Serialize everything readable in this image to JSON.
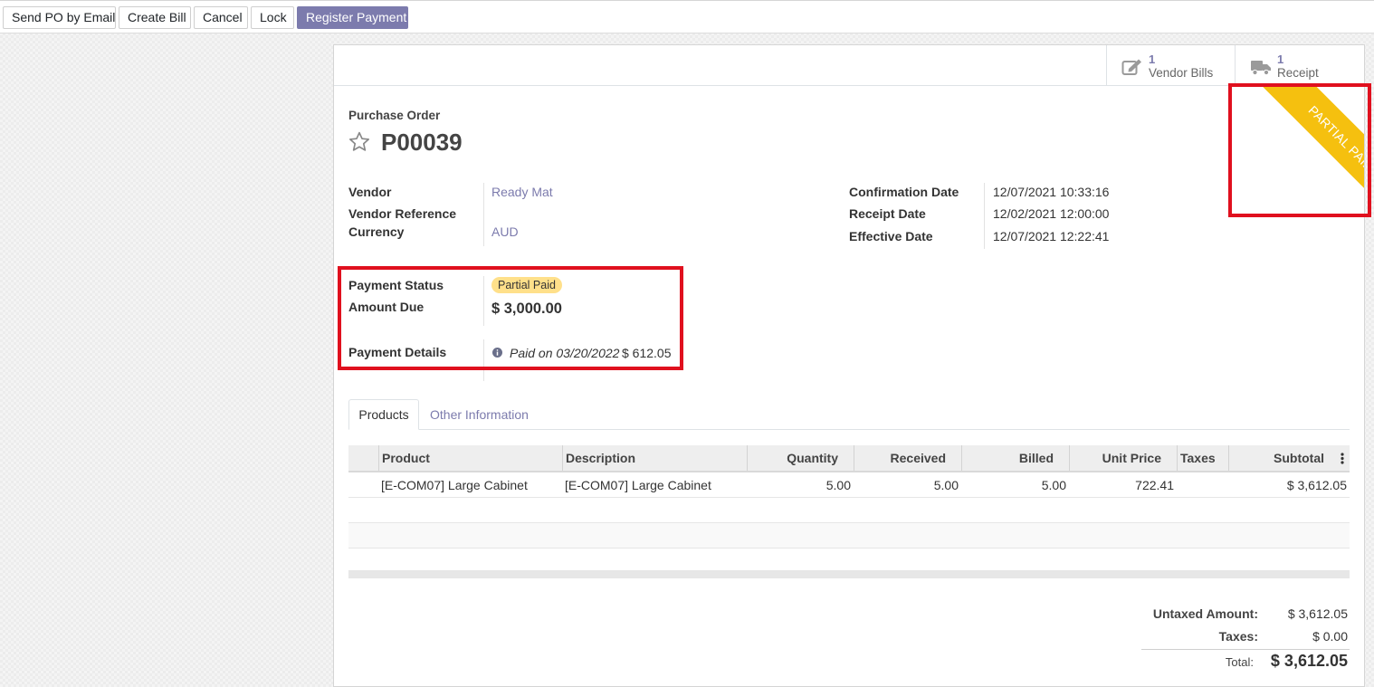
{
  "toolbar": {
    "send_po_email": "Send PO by Email",
    "create_bill": "Create Bill",
    "cancel": "Cancel",
    "lock": "Lock",
    "register_payment": "Register Payment"
  },
  "smart_buttons": {
    "vendor_bills": {
      "count": "1",
      "label": "Vendor Bills",
      "icon": "pencil-square-icon"
    },
    "receipt": {
      "count": "1",
      "label": "Receipt",
      "icon": "truck-icon"
    }
  },
  "ribbon": {
    "text": "PARTIAL PAID",
    "color": "#f5c00f"
  },
  "document": {
    "type_label": "Purchase Order",
    "name": "P00039"
  },
  "fields_left": {
    "vendor_label": "Vendor",
    "vendor_value": "Ready Mat",
    "vendor_ref_label": "Vendor Reference",
    "currency_label": "Currency",
    "currency_value": "AUD"
  },
  "fields_right": {
    "confirmation_label": "Confirmation Date",
    "confirmation_value": "12/07/2021 10:33:16",
    "receipt_label": "Receipt Date",
    "receipt_value": "12/02/2021 12:00:00",
    "effective_label": "Effective Date",
    "effective_value": "12/07/2021 12:22:41"
  },
  "payment": {
    "status_label": "Payment Status",
    "status_value": "Partial Paid",
    "amount_due_label": "Amount Due",
    "amount_due_value": "$ 3,000.00",
    "details_label": "Payment Details",
    "details_text": "Paid on 03/20/2022",
    "details_amount": "$ 612.05"
  },
  "tabs": {
    "products": "Products",
    "other_info": "Other Information"
  },
  "table": {
    "headers": {
      "product": "Product",
      "description": "Description",
      "quantity": "Quantity",
      "received": "Received",
      "billed": "Billed",
      "unit_price": "Unit Price",
      "taxes": "Taxes",
      "subtotal": "Subtotal"
    },
    "rows": [
      {
        "product": "[E-COM07] Large Cabinet",
        "description": "[E-COM07] Large Cabinet",
        "quantity": "5.00",
        "received": "5.00",
        "billed": "5.00",
        "unit_price": "722.41",
        "taxes": "",
        "subtotal": "$ 3,612.05"
      }
    ]
  },
  "totals": {
    "untaxed_label": "Untaxed Amount:",
    "untaxed_value": "$ 3,612.05",
    "taxes_label": "Taxes:",
    "taxes_value": "$ 0.00",
    "total_label": "Total:",
    "total_value": "$ 3,612.05"
  },
  "colors": {
    "accent": "#7c7bad",
    "ribbon": "#f5c00f",
    "badge": "#ffe08a",
    "highlight": "#e0101e"
  }
}
